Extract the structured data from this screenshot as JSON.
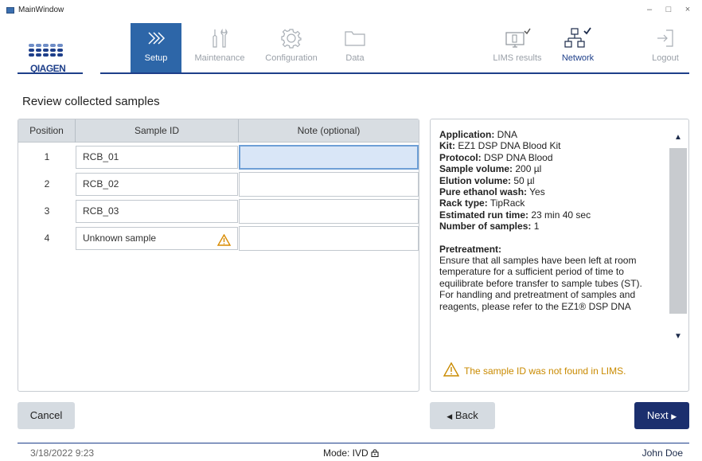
{
  "window": {
    "title": "MainWindow"
  },
  "nav": {
    "setup": "Setup",
    "maintenance": "Maintenance",
    "configuration": "Configuration",
    "data": "Data",
    "lims": "LIMS results",
    "network": "Network",
    "logout": "Logout"
  },
  "logo": {
    "text": "QIAGEN"
  },
  "page": {
    "title": "Review collected samples"
  },
  "table": {
    "headers": {
      "position": "Position",
      "sample_id": "Sample ID",
      "note": "Note (optional)"
    },
    "rows": [
      {
        "position": "1",
        "sample_id": "RCB_01",
        "note": ""
      },
      {
        "position": "2",
        "sample_id": "RCB_02",
        "note": ""
      },
      {
        "position": "3",
        "sample_id": "RCB_03",
        "note": ""
      },
      {
        "position": "4",
        "sample_id": "Unknown sample",
        "note": ""
      }
    ]
  },
  "info": {
    "application_label": "Application:",
    "application_value": " DNA",
    "kit_label": "Kit:",
    "kit_value": " EZ1 DSP DNA Blood Kit",
    "protocol_label": "Protocol:",
    "protocol_value": " DSP DNA Blood",
    "sample_volume_label": "Sample volume:",
    "sample_volume_value": " 200 µl",
    "elution_volume_label": "Elution volume:",
    "elution_volume_value": " 50 µl",
    "ethanol_label": "Pure ethanol wash:",
    "ethanol_value": " Yes",
    "rack_label": "Rack type:",
    "rack_value": " TipRack",
    "runtime_label": "Estimated run time:",
    "runtime_value": " 23 min 40 sec",
    "samples_label": "Number of samples:",
    "samples_value": " 1",
    "pretreatment_label": "Pretreatment:",
    "pretreatment_text1": "Ensure that all samples have been left at room temperature for a sufficient period of time to equilibrate before transfer to sample tubes (ST).",
    "pretreatment_text2": "For handling and pretreatment of samples and reagents, please refer to the EZ1® DSP DNA"
  },
  "warning": {
    "text": "The sample ID was not found in LIMS."
  },
  "buttons": {
    "cancel": "Cancel",
    "back": "Back",
    "next": "Next"
  },
  "status": {
    "datetime": "3/18/2022 9:23",
    "mode": "Mode: IVD",
    "user": "John Doe"
  },
  "colors": {
    "accent": "#2d66a8",
    "brand": "#1e3f8a",
    "warning": "#c98a00",
    "selected_cell": "#d9e6f7"
  }
}
